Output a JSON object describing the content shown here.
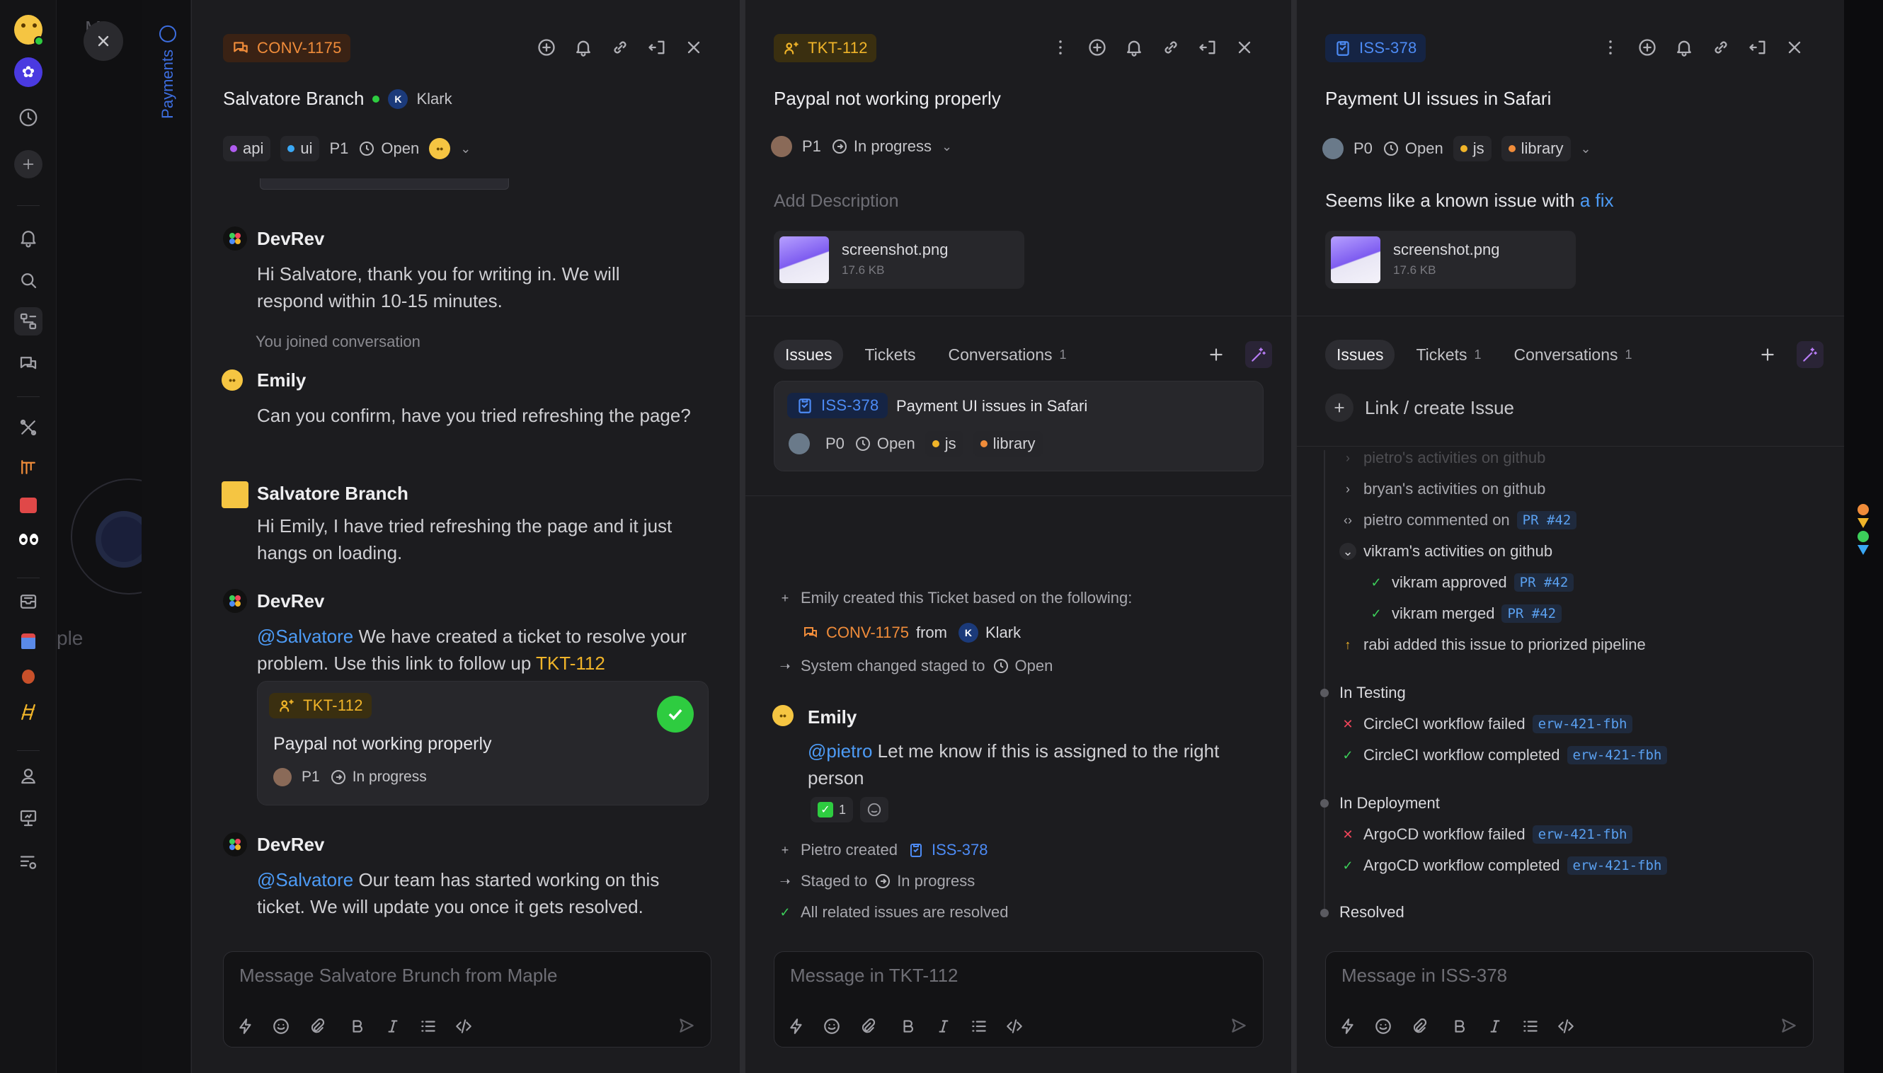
{
  "background": {
    "partial_text_top": "Ma",
    "partial_text_mid": "ple",
    "vertical_tab": "Payments"
  },
  "rail": {
    "icons": [
      "user-avatar",
      "maple-app-icon",
      "clock-icon",
      "plus-icon",
      "bell-icon",
      "search-icon",
      "flow-icon",
      "chat-icon",
      "tools-icon",
      "pipeline-icon",
      "train-icon",
      "eyes-icon",
      "inbox-icon",
      "robot-icon",
      "bug-icon",
      "ladder-icon",
      "support-icon",
      "presentation-icon",
      "list-settings-icon"
    ]
  },
  "panel1": {
    "tag": "CONV-1175",
    "customer": "Salvatore Branch",
    "org_initial": "K",
    "org": "Klark",
    "props": {
      "tag1": "api",
      "tag2": "ui",
      "priority": "P1",
      "status": "Open"
    },
    "messages": [
      {
        "author": "DevRev",
        "text": "Hi Salvatore, thank you for writing in. We will respond within 10-15 minutes."
      },
      {
        "note": "You joined conversation"
      },
      {
        "author": "Emily",
        "text": "Can you confirm, have you tried refreshing the page?"
      },
      {
        "author": "Salvatore Branch",
        "text": "Hi Emily, I have tried refreshing the page and it just hangs on loading."
      },
      {
        "author": "DevRev",
        "mention": "@Salvatore",
        "text": " We have created a ticket to resolve your problem. Use this link to follow up ",
        "link": "TKT-112"
      },
      {
        "author": "DevRev",
        "mention": "@Salvatore",
        "text": " Our team has started working on this ticket. We will update you once it gets resolved."
      }
    ],
    "ticket_card": {
      "tag": "TKT-112",
      "title": "Paypal not working properly",
      "priority": "P1",
      "status": "In progress"
    },
    "composer_placeholder": "Message Salvatore Brunch from Maple"
  },
  "panel2": {
    "tag": "TKT-112",
    "title": "Paypal not working properly",
    "props": {
      "priority": "P1",
      "status": "In progress"
    },
    "description_placeholder": "Add Description",
    "file": {
      "name": "screenshot.png",
      "size": "17.6 KB"
    },
    "tabs": [
      {
        "label": "Issues",
        "count": ""
      },
      {
        "label": "Tickets",
        "count": ""
      },
      {
        "label": "Conversations",
        "count": "1"
      }
    ],
    "issue_card": {
      "tag": "ISS-378",
      "title": "Payment UI issues in Safari",
      "priority": "P0",
      "status": "Open",
      "tag1": "js",
      "tag2": "library"
    },
    "activity": {
      "created": "Emily created this Ticket based on the following:",
      "source_tag": "CONV-1175",
      "from": "from",
      "source_org_initial": "K",
      "source_org": "Klark",
      "system_changed": "System changed staged to",
      "system_stage": "Open",
      "comment_author": "Emily",
      "comment_mention": "@pietro",
      "comment_text": " Let me know if this is assigned to the right person",
      "reaction_count": "1",
      "pietro_created": "Pietro created",
      "pietro_issue": "ISS-378",
      "staged_to": "Staged to",
      "staged_stage": "In progress",
      "resolved": "All related issues are resolved"
    },
    "composer_placeholder": "Message in TKT-112"
  },
  "panel3": {
    "tag": "ISS-378",
    "title": "Payment UI issues in Safari",
    "props": {
      "priority": "P0",
      "status": "Open",
      "tag1": "js",
      "tag2": "library"
    },
    "description_text": "Seems like a known issue with ",
    "description_link": "a fix",
    "file": {
      "name": "screenshot.png",
      "size": "17.6 KB"
    },
    "tabs": [
      {
        "label": "Issues",
        "count": ""
      },
      {
        "label": "Tickets",
        "count": "1"
      },
      {
        "label": "Conversations",
        "count": "1"
      }
    ],
    "link_create": "Link / create Issue",
    "timeline": {
      "faded_top": "pietro's activities on github",
      "bryan": "bryan's activities on github",
      "pietro_commented": "pietro commented on",
      "pr": "PR #42",
      "vikram": "vikram's activities on github",
      "vikram_approved": "vikram approved",
      "vikram_merged": "vikram merged",
      "rabi": "rabi added this issue to priorized pipeline",
      "in_testing": "In Testing",
      "circle_failed": "CircleCI workflow failed",
      "circle_completed": "CircleCI workflow completed",
      "in_deployment": "In Deployment",
      "argo_failed": "ArgoCD workflow failed",
      "argo_completed": "ArgoCD workflow completed",
      "branch": "erw-421-fbh",
      "resolved": "Resolved"
    },
    "composer_placeholder": "Message in ISS-378"
  },
  "colors": {
    "conv": "#f08c3a",
    "ticket": "#f0b429",
    "issue": "#4d8bf5",
    "mention": "#4d9bf5",
    "success": "#3ccf5a",
    "fail": "#f0455a",
    "api_dot": "#b05cf0",
    "ui_dot": "#3aa8f5",
    "js_dot": "#f0b429",
    "library_dot": "#f08c3a"
  }
}
